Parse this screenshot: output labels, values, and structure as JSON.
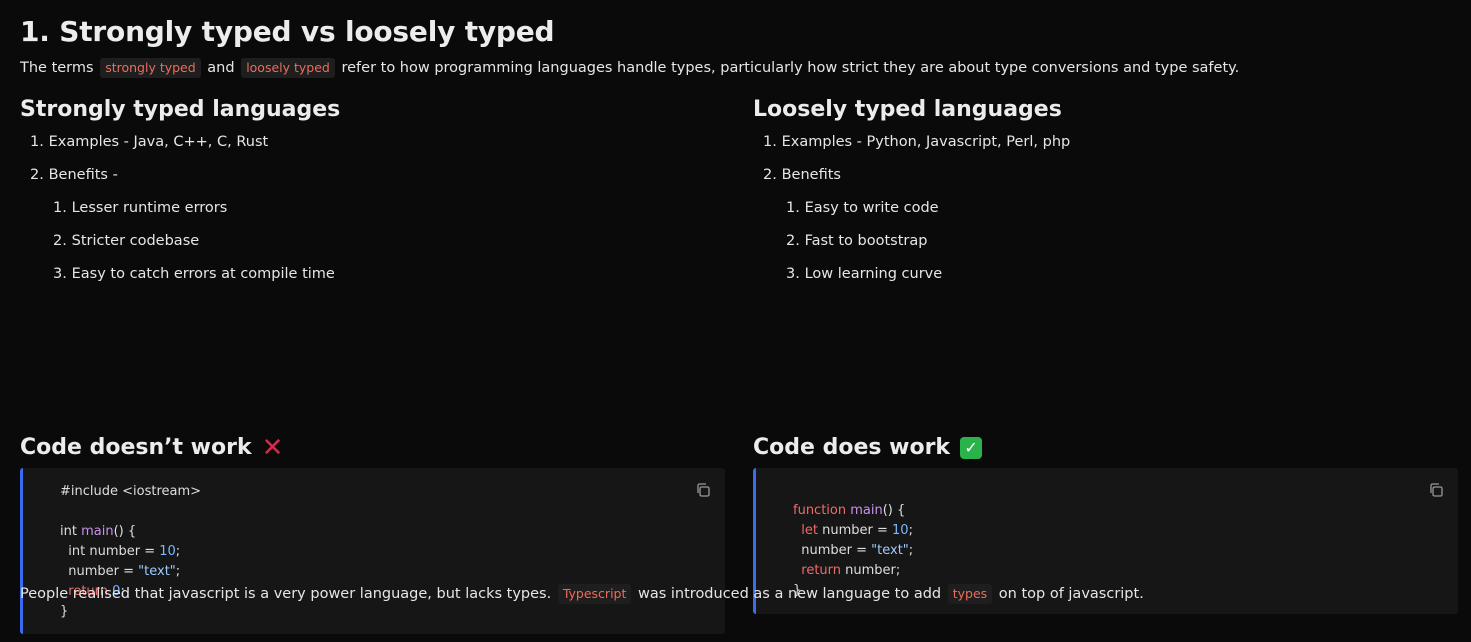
{
  "title": "1. Strongly typed vs loosely typed",
  "intro": {
    "before": "The terms",
    "code1": "strongly typed",
    "middle": "and",
    "code2": "loosely typed",
    "after": "refer to how programming languages handle types, particularly how strict they are about type conversions and type safety."
  },
  "strong": {
    "heading": "Strongly typed languages",
    "item1": "Examples - Java, C++, C, Rust",
    "item2": "Benefits -",
    "benefits": [
      "Lesser runtime errors",
      "Stricter codebase",
      "Easy to catch errors at compile time"
    ]
  },
  "loose": {
    "heading": "Loosely typed languages",
    "item1": "Examples - Python, Javascript, Perl, php",
    "item2": "Benefits",
    "benefits": [
      "Easy to write code",
      "Fast to bootstrap",
      "Low learning curve"
    ]
  },
  "numbers": [
    "1.",
    "2.",
    "3."
  ],
  "code_left": {
    "heading": "Code doesn’t work",
    "icon": "cross-mark-icon",
    "include": "#include <iostream>",
    "int1": "int ",
    "main": "main",
    "paren_open": "() {",
    "int2": "  int number = ",
    "num10": "10",
    "semi": ";",
    "assign": "  number = ",
    "text_str": "\"text\"",
    "ret_kw": "  return ",
    "zero": "0",
    "close": "}"
  },
  "code_right": {
    "heading": "Code does work",
    "icon": "check-mark-icon",
    "function_kw": "function ",
    "main": "main",
    "paren_open": "() {",
    "let_kw": "  let",
    "number_eq": " number = ",
    "num10": "10",
    "semi": ";",
    "assign": "  number = ",
    "text_str": "\"text\"",
    "ret_kw": "  return",
    "ret_rest": " number;",
    "close": "}"
  },
  "footer": {
    "before": "People realised that javascript is a very power language, but lacks types.",
    "code1": "Typescript",
    "middle": "was introduced as a new language to add",
    "code2": "types",
    "after": "on top of javascript."
  }
}
